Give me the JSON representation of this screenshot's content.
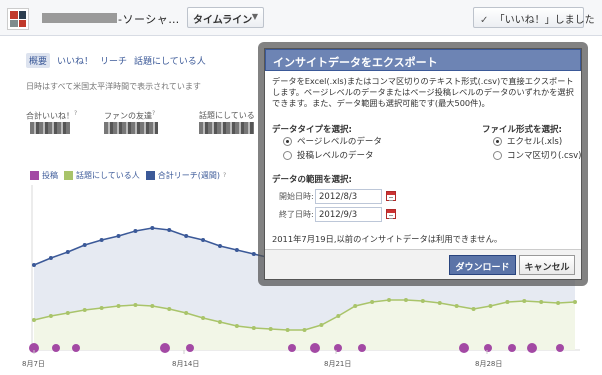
{
  "header": {
    "page_name": "-ソーシャ…",
    "timeline_label": "タイムライン",
    "liked_label": "「いいね！」しました"
  },
  "insights": {
    "tabs": [
      {
        "label": "概要"
      },
      {
        "label": "いいね！"
      },
      {
        "label": "リーチ"
      },
      {
        "label": "話題にしている人"
      }
    ],
    "timezone_note": "日時はすべて米国太平洋時間で表示されています",
    "stats": [
      {
        "label": "合計いいね！"
      },
      {
        "label": "ファンの友達"
      },
      {
        "label": "話題にしている"
      }
    ]
  },
  "chart_data": {
    "type": "line",
    "x_tick_labels": [
      "8月7日",
      "8月14日",
      "8月21日",
      "8月28日"
    ],
    "series": [
      {
        "name": "投稿",
        "color": "#a349a4"
      },
      {
        "name": "話題にしている人",
        "color": "#a9c46a"
      },
      {
        "name": "合計リーチ(週間)",
        "color": "#3b5998"
      }
    ],
    "legend_position": "top-left"
  },
  "dialog": {
    "title": "インサイトデータをエクスポート",
    "description": "データをExcel(.xls)またはコンマ区切りのテキスト形式(.csv)で直接エクスポートします。ページレベルのデータまたはページ投稿レベルのデータのいずれかを選択できます。また、データ範囲も選択可能です(最大500件)。",
    "data_type_label": "データタイプを選択:",
    "data_type_options": [
      "ページレベルのデータ",
      "投稿レベルのデータ"
    ],
    "file_format_label": "ファイル形式を選択:",
    "file_format_options": [
      "エクセル(.xls)",
      "コンマ区切り(.csv)"
    ],
    "range_label": "データの範囲を選択:",
    "start_label": "開始日時:",
    "start_value": "2012/8/3",
    "end_label": "終了日時:",
    "end_value": "2012/9/3",
    "availability_note": "2011年7月19日,以前のインサイトデータは利用できません。",
    "download_label": "ダウンロード",
    "cancel_label": "キャンセル"
  }
}
